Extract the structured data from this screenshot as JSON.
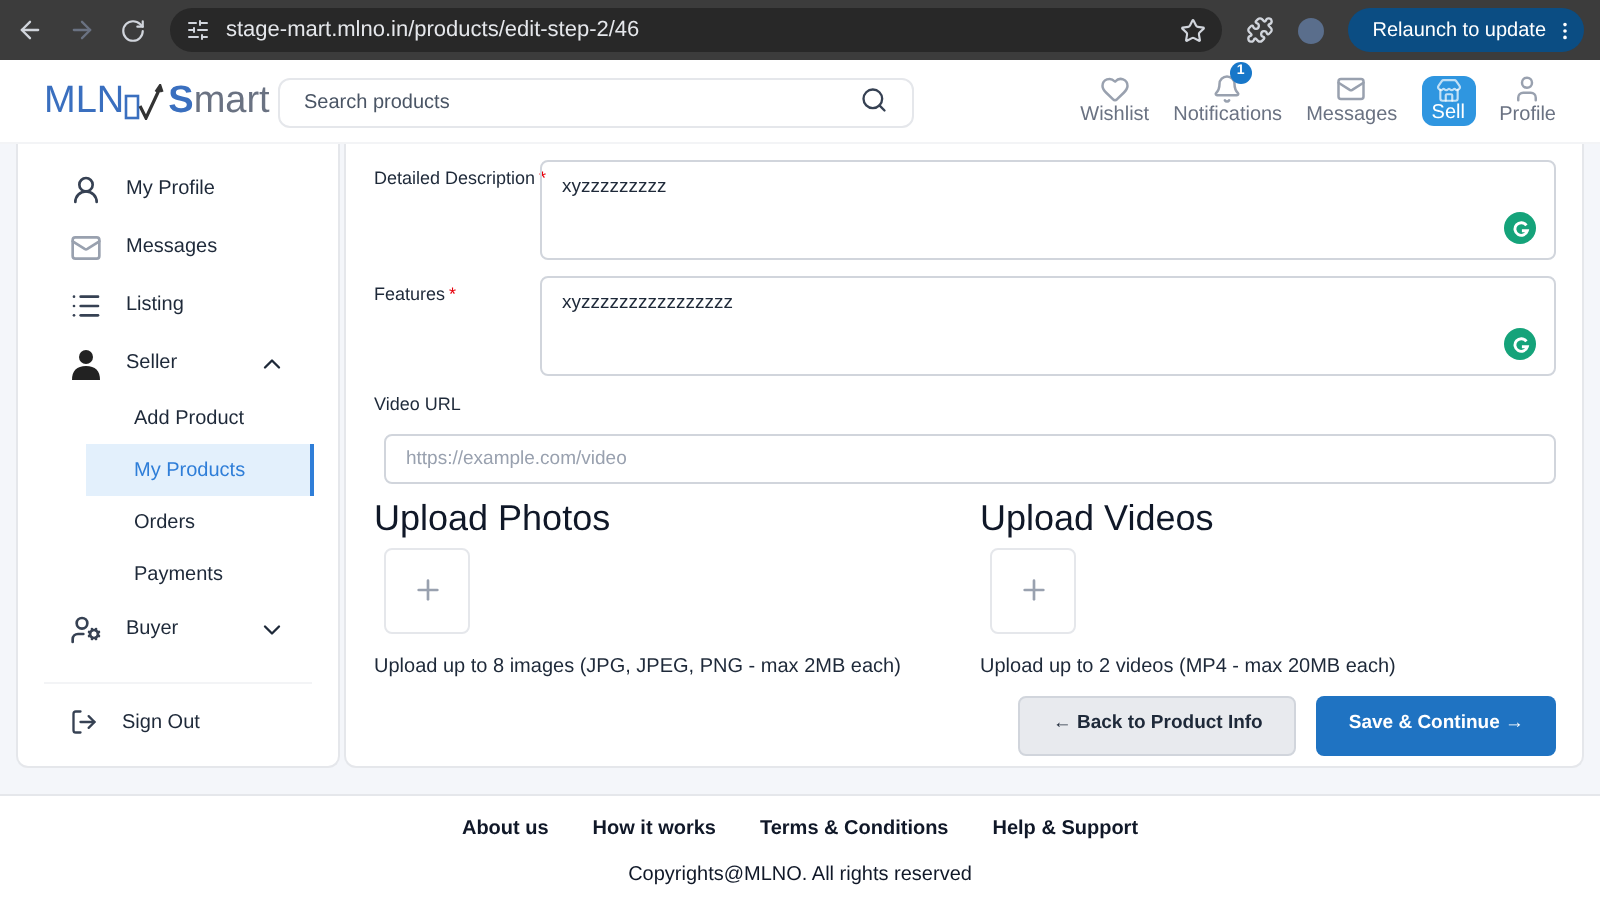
{
  "browser": {
    "url": "stage-mart.mlno.in/products/edit-step-2/46",
    "relaunch": "Relaunch to update"
  },
  "header": {
    "logo": {
      "left": "MLN",
      "right": "Smart"
    },
    "search": {
      "placeholder": "Search products"
    },
    "nav": [
      {
        "kind": "wishlist",
        "label": "Wishlist"
      },
      {
        "kind": "notifications",
        "label": "Notifications",
        "badge": "1"
      },
      {
        "kind": "messages",
        "label": "Messages"
      },
      {
        "kind": "sell",
        "label": "Sell"
      },
      {
        "kind": "profile",
        "label": "Profile"
      }
    ]
  },
  "sidebar": {
    "items": [
      {
        "kind": "profile",
        "label": "My Profile"
      },
      {
        "kind": "messages",
        "label": "Messages"
      },
      {
        "kind": "listing",
        "label": "Listing"
      },
      {
        "kind": "seller",
        "label": "Seller",
        "expanded": true,
        "children": [
          {
            "label": "Add Product",
            "selected": false
          },
          {
            "label": "My Products",
            "selected": true
          },
          {
            "label": "Orders",
            "selected": false
          },
          {
            "label": "Payments",
            "selected": false
          }
        ]
      },
      {
        "kind": "buyer",
        "label": "Buyer",
        "expanded": false
      }
    ],
    "sign_out": "Sign Out"
  },
  "form": {
    "fields": [
      {
        "kind": "textarea",
        "label": "Detailed Description",
        "required_mark": "*",
        "value": "xyzzzzzzzzz"
      },
      {
        "kind": "textarea",
        "label": "Features",
        "required_mark": "*",
        "value": "xyzzzzzzzzzzzzzzzz"
      },
      {
        "kind": "input",
        "label": "Video URL",
        "placeholder": "https://example.com/video"
      }
    ],
    "uploads": [
      {
        "title": "Upload Photos",
        "hint": "Upload up to 8 images (JPG, JPEG, PNG - max 2MB each)"
      },
      {
        "title": "Upload Videos",
        "hint": "Upload up to 2 videos (MP4 - max 20MB each)"
      }
    ],
    "buttons": [
      {
        "kind": "secondary",
        "label": "← Back to Product Info"
      },
      {
        "kind": "primary",
        "label": "Save & Continue →"
      }
    ]
  },
  "footer": {
    "links": [
      "About us",
      "How it works",
      "Terms & Conditions",
      "Help & Support"
    ],
    "copyright": "Copyrights@MLNO. All rights reserved"
  }
}
